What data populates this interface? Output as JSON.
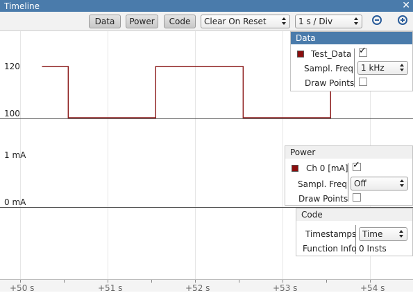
{
  "window": {
    "title": "Timeline",
    "close_glyph": "✕"
  },
  "toolbar": {
    "tabs": [
      "Data",
      "Power",
      "Code"
    ],
    "reset_mode": "Clear On Reset",
    "time_scale": "1 s / Div",
    "zoom_out": "zoom-out-icon",
    "zoom_in": "zoom-in-icon"
  },
  "plots": {
    "data_y_high": "120",
    "data_y_low": "100",
    "power_y_high": "1 mA",
    "power_y_low": "0 mA",
    "signal_color": "#8b1a1a"
  },
  "chart_data": {
    "type": "line",
    "step": true,
    "series": [
      {
        "name": "Test_Data",
        "x": [
          50.25,
          50.55,
          50.55,
          51.55,
          51.55,
          52.55,
          52.55,
          53.55,
          53.55
        ],
        "y": [
          120,
          120,
          100,
          100,
          120,
          120,
          100,
          100,
          120
        ]
      }
    ],
    "ylim": [
      100,
      120
    ],
    "xlim": [
      49.9,
      54.3
    ],
    "x_ticks": [
      "+50 s",
      "+51 s",
      "+52 s",
      "+53 s",
      "+54 s"
    ]
  },
  "data_panel": {
    "title": "Data",
    "channel": "Test_Data",
    "channel_checked": true,
    "freq_label": "Sampl. Freq",
    "freq_value": "1 kHz",
    "draw_label": "Draw Points",
    "draw_checked": false
  },
  "power_panel": {
    "title": "Power",
    "channel": "Ch 0 [mA]",
    "channel_checked": true,
    "freq_label": "Sampl. Freq",
    "freq_value": "Off",
    "draw_label": "Draw Points",
    "draw_checked": false
  },
  "code_panel": {
    "title": "Code",
    "ts_label": "Timestamps",
    "ts_value": "Time",
    "fi_label": "Function Info",
    "fi_value": "0 Insts"
  },
  "icons": {
    "check": "✓"
  },
  "colors": {
    "titlebar": "#4a7bab",
    "panel_header": "#4a7bab",
    "signal": "#8b1a1a"
  }
}
